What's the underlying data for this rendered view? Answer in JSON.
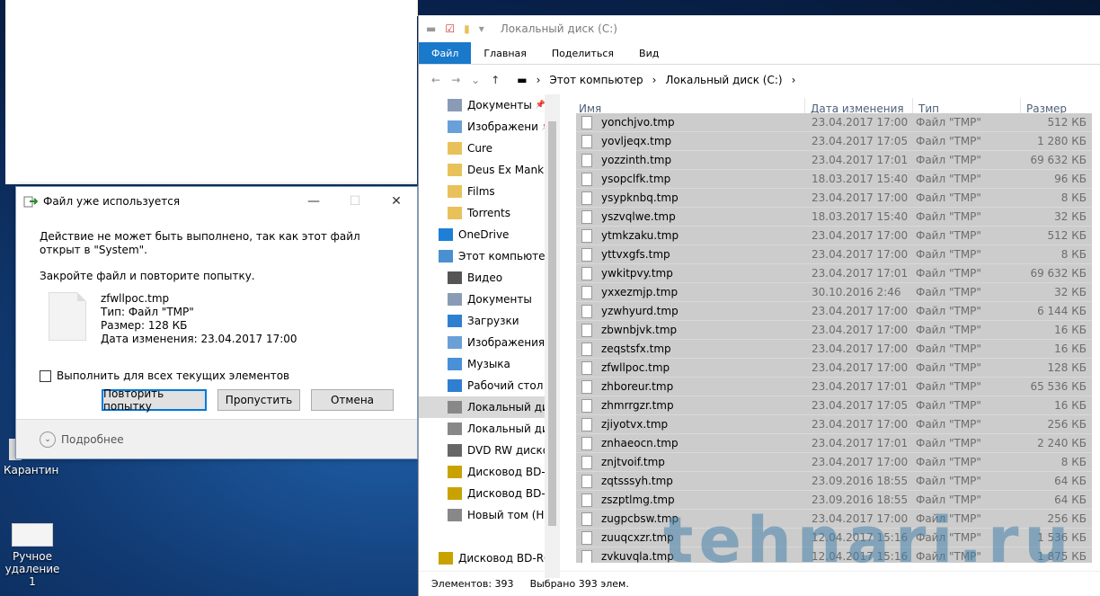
{
  "desktop": {
    "icons": [
      {
        "label": "Карантин"
      },
      {
        "label": "Ручное удаление 1"
      }
    ]
  },
  "dialog": {
    "title": "Файл уже используется",
    "message": "Действие не может быть выполнено, так как этот файл открыт в \"System\".",
    "hint": "Закройте файл и повторите попытку.",
    "file": {
      "name": "zfwllpoc.tmp",
      "type": "Тип: Файл \"TMP\"",
      "size": "Размер: 128 КБ",
      "modified": "Дата изменения: 23.04.2017 17:00"
    },
    "checkbox_label": "Выполнить для всех текущих элементов",
    "buttons": {
      "retry": "Повторить попытку",
      "skip": "Пропустить",
      "cancel": "Отмена"
    },
    "details": "Подробнее"
  },
  "explorer": {
    "title": "Локальный диск (C:)",
    "ribbon_tabs": [
      "Файл",
      "Главная",
      "Поделиться",
      "Вид"
    ],
    "breadcrumb": [
      "Этот компьютер",
      "Локальный диск (C:)"
    ],
    "nav": [
      {
        "label": "Документы",
        "level": 2,
        "icon": "documents-icon",
        "pinned": true
      },
      {
        "label": "Изображени",
        "level": 2,
        "icon": "pictures-icon",
        "pinned": true
      },
      {
        "label": "Cure",
        "level": 2,
        "icon": "folder-icon"
      },
      {
        "label": "Deus Ex Mankind",
        "level": 2,
        "icon": "folder-icon"
      },
      {
        "label": "Films",
        "level": 2,
        "icon": "folder-icon"
      },
      {
        "label": "Torrents",
        "level": 2,
        "icon": "folder-icon"
      },
      {
        "label": "OneDrive",
        "level": 1,
        "icon": "onedrive-icon"
      },
      {
        "label": "Этот компьютер",
        "level": 1,
        "icon": "computer-icon"
      },
      {
        "label": "Видео",
        "level": 2,
        "icon": "video-icon"
      },
      {
        "label": "Документы",
        "level": 2,
        "icon": "documents-icon"
      },
      {
        "label": "Загрузки",
        "level": 2,
        "icon": "downloads-icon"
      },
      {
        "label": "Изображения",
        "level": 2,
        "icon": "pictures-icon"
      },
      {
        "label": "Музыка",
        "level": 2,
        "icon": "music-icon"
      },
      {
        "label": "Рабочий стол",
        "level": 2,
        "icon": "desktop-icon"
      },
      {
        "label": "Локальный дис",
        "level": 2,
        "icon": "drive-icon",
        "selected": true
      },
      {
        "label": "Локальный дис",
        "level": 2,
        "icon": "drive-icon"
      },
      {
        "label": "DVD RW дисков",
        "level": 2,
        "icon": "dvd-icon"
      },
      {
        "label": "Дисковод BD-RO",
        "level": 2,
        "icon": "bd-icon"
      },
      {
        "label": "Дисковод BD-RO",
        "level": 2,
        "icon": "bd-icon"
      },
      {
        "label": "Новый том (H:)",
        "level": 2,
        "icon": "drive-icon"
      },
      {
        "label": "",
        "level": 2,
        "icon": "blank"
      },
      {
        "label": "Дисковод BD-ROI",
        "level": 1,
        "icon": "bd-icon"
      }
    ],
    "columns": [
      "Имя",
      "Дата изменения",
      "Тип",
      "Размер"
    ],
    "files": [
      [
        "yonchjvo.tmp",
        "23.04.2017 17:00",
        "Файл \"TMP\"",
        "512 КБ"
      ],
      [
        "yovljeqx.tmp",
        "23.04.2017 17:05",
        "Файл \"TMP\"",
        "1 280 КБ"
      ],
      [
        "yozzinth.tmp",
        "23.04.2017 17:01",
        "Файл \"TMP\"",
        "69 632 КБ"
      ],
      [
        "ysopclfk.tmp",
        "18.03.2017 15:40",
        "Файл \"TMP\"",
        "96 КБ"
      ],
      [
        "ysypknbq.tmp",
        "23.04.2017 17:00",
        "Файл \"TMP\"",
        "8 КБ"
      ],
      [
        "yszvqlwe.tmp",
        "18.03.2017 15:40",
        "Файл \"TMP\"",
        "32 КБ"
      ],
      [
        "ytmkzaku.tmp",
        "23.04.2017 17:00",
        "Файл \"TMP\"",
        "512 КБ"
      ],
      [
        "yttvxgfs.tmp",
        "23.04.2017 17:00",
        "Файл \"TMP\"",
        "8 КБ"
      ],
      [
        "ywkitpvy.tmp",
        "23.04.2017 17:01",
        "Файл \"TMP\"",
        "69 632 КБ"
      ],
      [
        "yxxezmjp.tmp",
        "30.10.2016 2:46",
        "Файл \"TMP\"",
        "32 КБ"
      ],
      [
        "yzwhyurd.tmp",
        "23.04.2017 17:00",
        "Файл \"TMP\"",
        "6 144 КБ"
      ],
      [
        "zbwnbjvk.tmp",
        "23.04.2017 17:00",
        "Файл \"TMP\"",
        "16 КБ"
      ],
      [
        "zeqstsfx.tmp",
        "23.04.2017 17:00",
        "Файл \"TMP\"",
        "16 КБ"
      ],
      [
        "zfwllpoc.tmp",
        "23.04.2017 17:00",
        "Файл \"TMP\"",
        "128 КБ"
      ],
      [
        "zhboreur.tmp",
        "23.04.2017 17:01",
        "Файл \"TMP\"",
        "65 536 КБ"
      ],
      [
        "zhmrrgzr.tmp",
        "23.04.2017 17:05",
        "Файл \"TMP\"",
        "16 КБ"
      ],
      [
        "zjiyotvx.tmp",
        "23.04.2017 17:00",
        "Файл \"TMP\"",
        "256 КБ"
      ],
      [
        "znhaeocn.tmp",
        "23.04.2017 17:01",
        "Файл \"TMP\"",
        "2 240 КБ"
      ],
      [
        "znjtvoif.tmp",
        "23.04.2017 17:00",
        "Файл \"TMP\"",
        "8 КБ"
      ],
      [
        "zqtsssyh.tmp",
        "23.09.2016 18:55",
        "Файл \"TMP\"",
        "64 КБ"
      ],
      [
        "zszptlmg.tmp",
        "23.09.2016 18:55",
        "Файл \"TMP\"",
        "64 КБ"
      ],
      [
        "zugpcbsw.tmp",
        "23.04.2017 17:00",
        "Файл \"TMP\"",
        "256 КБ"
      ],
      [
        "zuuqcxzr.tmp",
        "12.04.2017 15:16",
        "Файл \"TMP\"",
        "1 536 КБ"
      ],
      [
        "zvkuvqla.tmp",
        "12.04.2017 15:16",
        "Файл \"TMP\"",
        "1 875 КБ"
      ]
    ],
    "status": {
      "count": "Элементов: 393",
      "selected": "Выбрано 393 элем."
    }
  },
  "watermark": "tehnari.ru"
}
